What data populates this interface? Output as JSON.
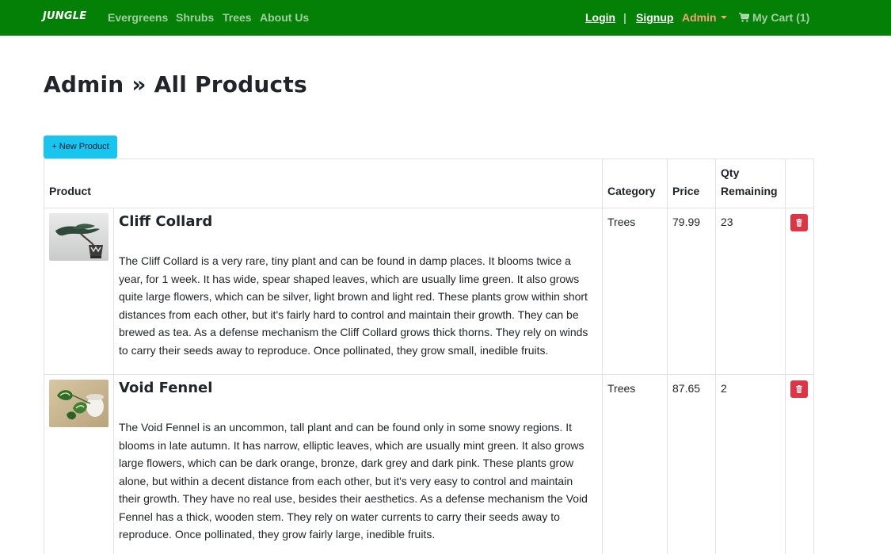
{
  "navbar": {
    "brand": "JUNGLE",
    "links": [
      "Evergreens",
      "Shrubs",
      "Trees",
      "About Us"
    ],
    "login": "Login",
    "separator": "|",
    "signup": "Signup",
    "admin": "Admin",
    "cart": "My Cart (1)",
    "colors": {
      "background": "#058006",
      "admin": "#f4a27a"
    }
  },
  "page": {
    "title": "Admin » All Products",
    "new_button": "+ New Product"
  },
  "table": {
    "headers": {
      "product": "Product",
      "category": "Category",
      "price": "Price",
      "qty_line1": "Qty",
      "qty_line2": "Remaining"
    },
    "rows": [
      {
        "image_icon": "bonsai-image",
        "name": "Cliff Collard",
        "description": "The Cliff Collard is a very rare, tiny plant and can be found in damp places. It blooms twice a year, for 1 week. It has wide, spear shaped leaves, which are usually lime green. It also grows quite large flowers, which can be silver, light brown and light red. These plants grow within short distances from each other, but it's fairly hard to control and maintain their growth. They can be brewed as tea. As a defense mechanism the Cliff Collard grows thick thorns. They rely on winds to carry their seeds away to reproduce. Once pollinated, they grow small, inedible fruits.",
        "category": "Trees",
        "price": "79.99",
        "qty": "23"
      },
      {
        "image_icon": "pothos-image",
        "name": "Void Fennel",
        "description": "The Void Fennel is an uncommon, tall plant and can be found only in some snowy regions. It blooms in late autumn. It has narrow, elliptic leaves, which are usually mint green. It also grows large flowers, which can be dark orange, bronze, dark grey and dark pink. These plants grow alone, but within a decent distance from each other, but it's very easy to control and maintain their growth. They have no real use, besides their aesthetics. As a defense mechanism the Void Fennel has a thick, wooden stem. They rely on water currents to carry their seeds away to reproduce. Once pollinated, they grow fairly large, inedible fruits.",
        "category": "Trees",
        "price": "87.65",
        "qty": "2"
      }
    ],
    "delete_icon": "trash-icon",
    "delete_color": "#dc3545"
  }
}
